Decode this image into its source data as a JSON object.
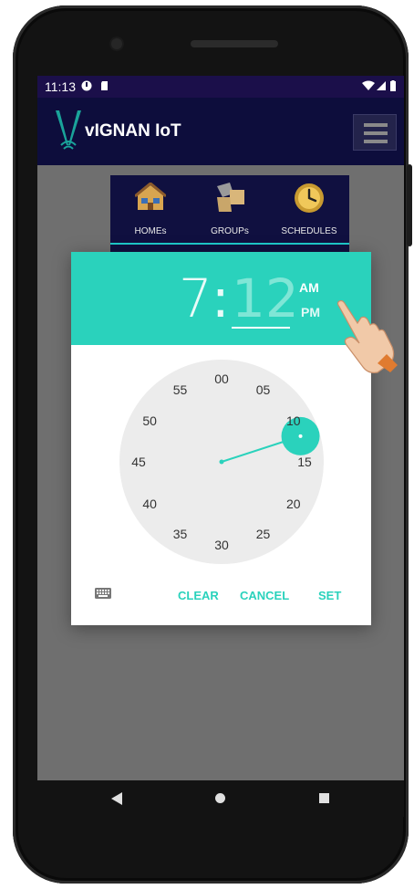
{
  "status_bar": {
    "time": "11:13",
    "icons": [
      "data-saver-icon",
      "sd-card-icon",
      "wifi-icon",
      "signal-icon",
      "battery-icon"
    ]
  },
  "app_bar": {
    "title": "vIGNAN IoT",
    "logo_icon": "vignan-v-logo-icon",
    "menu_icon": "hamburger-menu-icon"
  },
  "tabs": [
    {
      "label": "HOMEs",
      "icon": "house-icon"
    },
    {
      "label": "GROUPs",
      "icon": "puzzle-icon"
    },
    {
      "label": "SCHEDULES",
      "icon": "clock-icon"
    }
  ],
  "time_picker": {
    "hour": "7",
    "separator": ":",
    "minute": "12",
    "am_label": "AM",
    "pm_label": "PM",
    "selected_period": "AM",
    "clock_numbers": [
      "00",
      "05",
      "10",
      "15",
      "20",
      "25",
      "30",
      "35",
      "40",
      "45",
      "50",
      "55"
    ],
    "selected_minute": 12,
    "keyboard_icon": "keyboard-icon",
    "clear_label": "CLEAR",
    "cancel_label": "CANCEL",
    "set_label": "SET"
  },
  "nav_bar": {
    "back_icon": "back-triangle-icon",
    "home_icon": "home-circle-icon",
    "recents_icon": "recents-square-icon"
  },
  "colors": {
    "accent": "#2ad2bc",
    "status_bar": "#1b0f4a",
    "app_bar": "#0d0d3c",
    "scrim": "#6e6e6e"
  }
}
